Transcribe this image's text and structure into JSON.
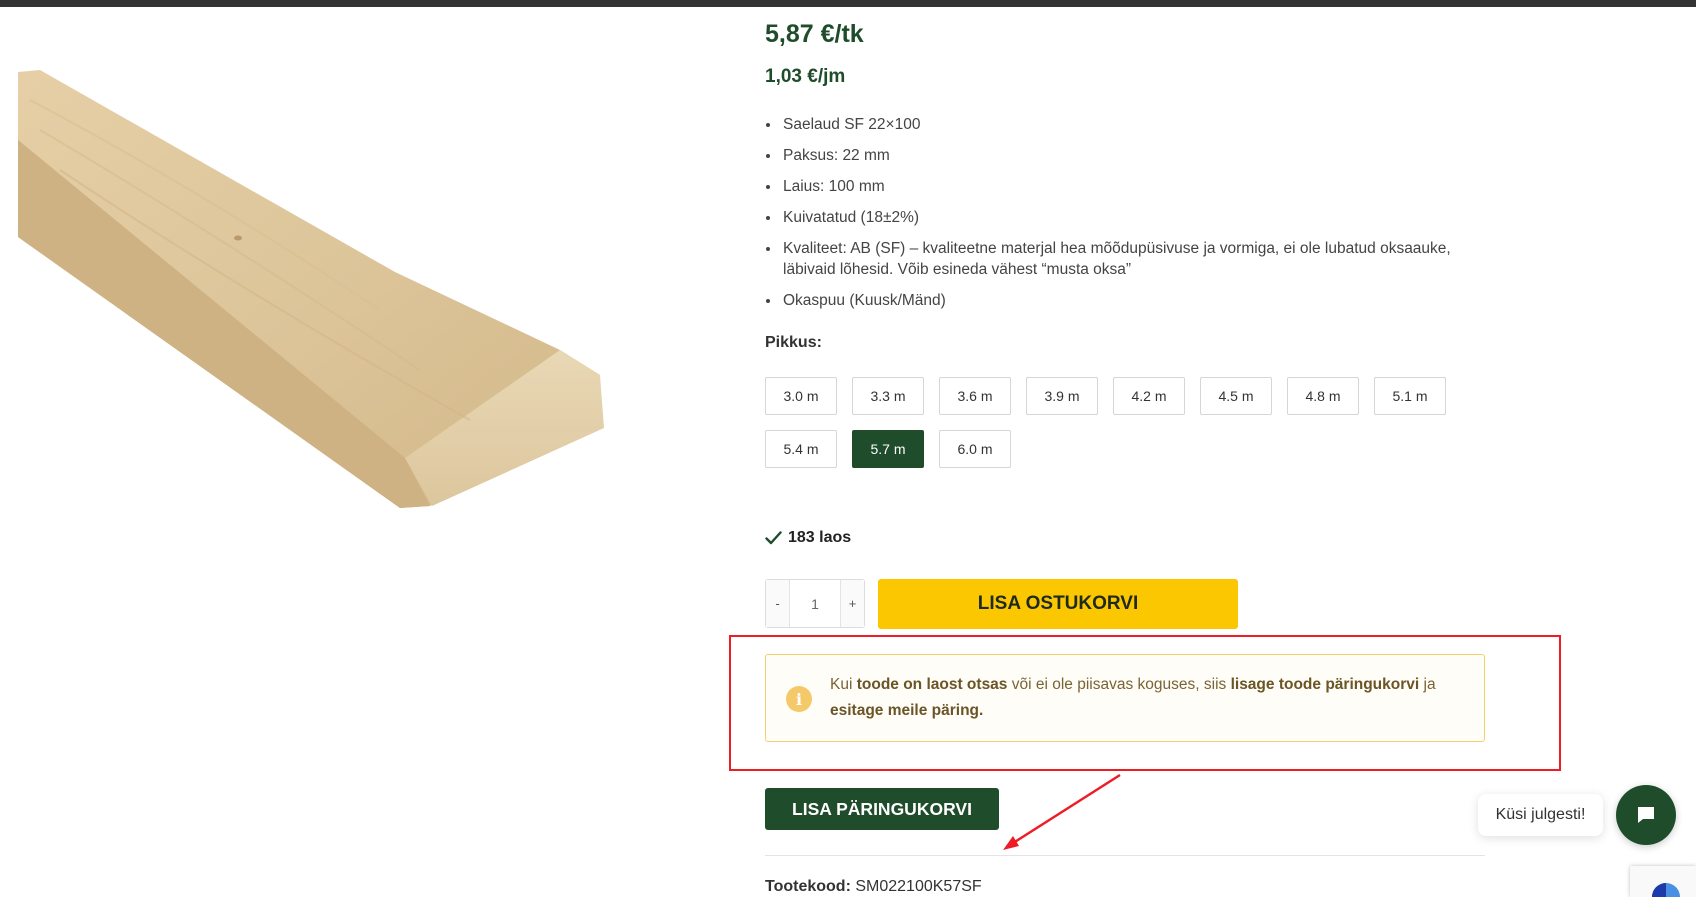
{
  "product": {
    "price_main": "5,87 €/tk",
    "price_per_unit": "1,03 €/jm",
    "image_alt": "Saelaud",
    "features": [
      "Saelaud SF 22×100",
      "Paksus: 22 mm",
      "Laius: 100 mm",
      "Kuivatatud (18±2%)",
      "Kvaliteet: AB (SF) – kvaliteetne materjal hea mõõdupüsivuse ja vormiga, ei ole lubatud oksaauke, läbivaid lõhesid. Võib esineda vähest “musta oksa”",
      "Okaspuu (Kuusk/Mänd)"
    ],
    "length_label": "Pikkus",
    "length_options": [
      "3.0 m",
      "3.3 m",
      "3.6 m",
      "3.9 m",
      "4.2 m",
      "4.5 m",
      "4.8 m",
      "5.1 m",
      "5.4 m",
      "5.7 m",
      "6.0 m"
    ],
    "selected_length": "5.7 m",
    "stock_text": "183 laos",
    "quantity": "1",
    "qty_minus": "-",
    "qty_plus": "+",
    "add_to_cart": "LISA OSTUKORVI",
    "add_to_inquiry": "LISA PÄRINGUKORVI",
    "sku_label": "Tootekood:",
    "sku_value": "SM022100K57SF"
  },
  "notice": {
    "icon": "info-icon",
    "segments": [
      {
        "text": "Kui ",
        "bold": false
      },
      {
        "text": "toode on laost otsas",
        "bold": true
      },
      {
        "text": " või ei ole piisavas koguses, siis ",
        "bold": false
      },
      {
        "text": "lisage toode päringukorvi",
        "bold": true
      },
      {
        "text": " ja ",
        "bold": false
      },
      {
        "text": "esitage meile päring.",
        "bold": true
      }
    ]
  },
  "chat": {
    "bubble_text": "Küsi julgesti!",
    "icon": "chat-icon"
  },
  "colors": {
    "brand_green": "#1f4d2b",
    "cart_yellow": "#fbc700",
    "annotation_red": "#ee1c25",
    "notice_border": "#f3cf6f"
  }
}
